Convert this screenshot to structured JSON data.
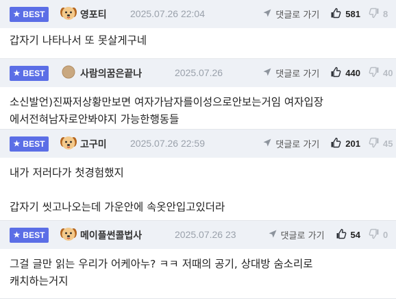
{
  "comments": [
    {
      "badge": "BEST",
      "nickname": "영포티",
      "avatar_icon": "puppy-face-icon",
      "date": "2025.07.26 22:04",
      "reply_label": "댓글로 가기",
      "likes": "581",
      "dislikes": "8",
      "lines": [
        "갑자기 나타나서 또 못살게구네"
      ]
    },
    {
      "badge": "BEST",
      "nickname": "사람의꿈은끝나",
      "avatar_icon": "round-avatar-icon",
      "date": "2025.07.26",
      "reply_label": "댓글로 가기",
      "likes": "440",
      "dislikes": "40",
      "lines": [
        "소신발언)진짜저상황만보면 여자가남자를이성으로안보는거임 여자입장",
        "에서전혀남자로안봐야지 가능한행동들"
      ]
    },
    {
      "badge": "BEST",
      "nickname": "고구미",
      "avatar_icon": "puppy-face-icon",
      "date": "2025.07.26 22:59",
      "reply_label": "댓글로 가기",
      "likes": "201",
      "dislikes": "45",
      "lines": [
        "내가 저러다가 첫경험했지",
        "",
        "갑자기 씻고나오는데 가운안에 속옷안입고있더라"
      ]
    },
    {
      "badge": "BEST",
      "nickname": "메이플썬콜법사",
      "avatar_icon": "puppy-face-icon",
      "date": "2025.07.26 23",
      "reply_label": "댓글로 가기",
      "likes": "54",
      "dislikes": "0",
      "lines": [
        "그걸 글만 읽는 우리가 어케아누? ㅋㅋ 저때의 공기, 상대방 숨소리로",
        "캐치하는거지"
      ]
    }
  ],
  "colors": {
    "badge": "#5b6ee6",
    "header_bg": "#eef1f6",
    "muted": "#9aa1ab"
  }
}
